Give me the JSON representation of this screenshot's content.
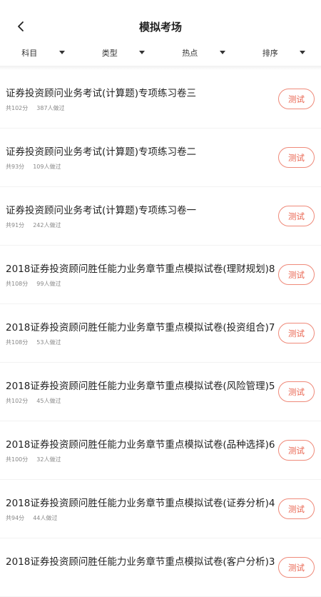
{
  "header": {
    "title": "模拟考场",
    "back_icon": "chevron-left-icon"
  },
  "filters": [
    {
      "label": "科目",
      "icon": "caret-down-icon"
    },
    {
      "label": "类型",
      "icon": "caret-down-icon"
    },
    {
      "label": "热点",
      "icon": "caret-down-icon"
    },
    {
      "label": "排序",
      "icon": "caret-down-icon"
    }
  ],
  "colors": {
    "accent": "#e9634e",
    "accent_border": "#ef8a7a",
    "meta_text": "#888888"
  },
  "items": [
    {
      "title": "证券投资顾问业务考试(计算题)专项练习卷三",
      "total": "共102分",
      "count": "387人做过",
      "button": "测试"
    },
    {
      "title": "证券投资顾问业务考试(计算题)专项练习卷二",
      "total": "共93分",
      "count": "109人做过",
      "button": "测试"
    },
    {
      "title": "证券投资顾问业务考试(计算题)专项练习卷一",
      "total": "共91分",
      "count": "242人做过",
      "button": "测试"
    },
    {
      "title": "2018证券投资顾问胜任能力业务章节重点模拟试卷(理财规划)8",
      "total": "共108分",
      "count": "99人做过",
      "button": "测试"
    },
    {
      "title": "2018证券投资顾问胜任能力业务章节重点模拟试卷(投资组合)7",
      "total": "共108分",
      "count": "53人做过",
      "button": "测试"
    },
    {
      "title": "2018证券投资顾问胜任能力业务章节重点模拟试卷(风险管理)5",
      "total": "共102分",
      "count": "45人做过",
      "button": "测试"
    },
    {
      "title": "2018证券投资顾问胜任能力业务章节重点模拟试卷(品种选择)6",
      "total": "共100分",
      "count": "32人做过",
      "button": "测试"
    },
    {
      "title": "2018证券投资顾问胜任能力业务章节重点模拟试卷(证券分析)4",
      "total": "共94分",
      "count": "44人做过",
      "button": "测试"
    },
    {
      "title": "2018证券投资顾问胜任能力业务章节重点模拟试卷(客户分析)3",
      "total": "",
      "count": "",
      "button": "测试"
    }
  ]
}
